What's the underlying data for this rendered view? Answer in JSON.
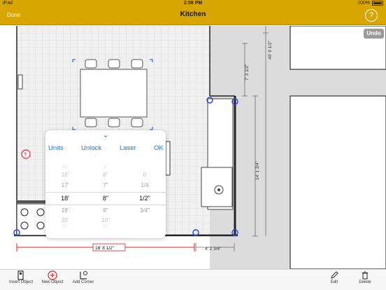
{
  "status": {
    "device": "iPad",
    "time": "2:08 PM",
    "battery": "100%"
  },
  "nav": {
    "done_label": "Done",
    "title": "Kitchen",
    "help_label": "?"
  },
  "canvas": {
    "undo_label": "Undo",
    "dim_room_vertical": "40' 9 1/2\"",
    "dim_upper": "7' 3 1/2\"",
    "dim_right": "14' 1 3/4\"",
    "dim_bottom_selected": "18' 8 1/2\"",
    "dim_bottom_right": "4' 2 3/4\""
  },
  "picker": {
    "buttons": {
      "units": "Units",
      "unlock": "Unlock",
      "laser": "Laser",
      "ok": "OK"
    },
    "feet": [
      "15'",
      "16'",
      "17'",
      "18'",
      "19'",
      "20'",
      "21'"
    ],
    "inches": [
      "5\"",
      "6\"",
      "7\"",
      "8\"",
      "9\"",
      "10\"",
      "11\""
    ],
    "fractions": [
      "",
      "0",
      "1/4",
      "1/2\"",
      "3/4\"",
      "",
      ""
    ]
  },
  "toolbar": {
    "insert_object": "Insert Object",
    "new_object": "New Object",
    "add_corner": "Add Corner",
    "edit": "Edit",
    "delete": "Delete"
  },
  "colors": {
    "accent": "#d7a600",
    "link": "#1f7ae0",
    "selected_dim": "#e0242a"
  }
}
